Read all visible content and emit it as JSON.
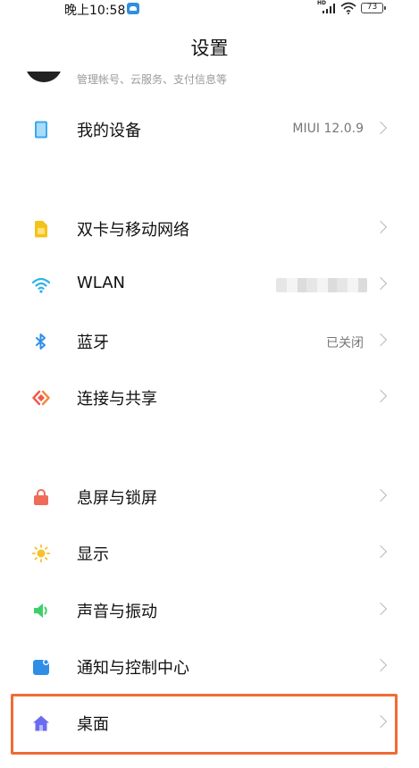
{
  "status_bar": {
    "time": "晚上10:58",
    "battery": "73",
    "network_label": "HD"
  },
  "header": {
    "title": "设置"
  },
  "account": {
    "subtitle": "管理帐号、云服务、支付信息等"
  },
  "colors": {
    "highlight_border": "#f06b35",
    "chevron": "#b8b8b8",
    "device_icon": "#3ba8f0",
    "sim_icon": "#f5c21a",
    "wifi_icon": "#2fb2e6",
    "bluetooth_icon": "#2f8fe6",
    "share_icon": "#ef5a4a",
    "lock_icon": "#ef6c5a",
    "display_icon": "#f7c12a",
    "sound_icon": "#3fcf6a",
    "notification_icon": "#2f8fe6",
    "home_icon": "#6a6cf0"
  },
  "settings_rows": [
    {
      "label": "我的设备",
      "value": "MIUI 12.0.9",
      "icon": "device-icon"
    },
    {
      "label": "双卡与移动网络",
      "value": "",
      "icon": "sim-card-icon"
    },
    {
      "label": "WLAN",
      "value": "",
      "icon": "wifi-icon"
    },
    {
      "label": "蓝牙",
      "value": "已关闭",
      "icon": "bluetooth-icon"
    },
    {
      "label": "连接与共享",
      "value": "",
      "icon": "share-icon"
    },
    {
      "label": "息屏与锁屏",
      "value": "",
      "icon": "lock-icon"
    },
    {
      "label": "显示",
      "value": "",
      "icon": "sun-icon"
    },
    {
      "label": "声音与振动",
      "value": "",
      "icon": "speaker-icon"
    },
    {
      "label": "通知与控制中心",
      "value": "",
      "icon": "notification-icon"
    },
    {
      "label": "桌面",
      "value": "",
      "icon": "home-icon"
    }
  ]
}
